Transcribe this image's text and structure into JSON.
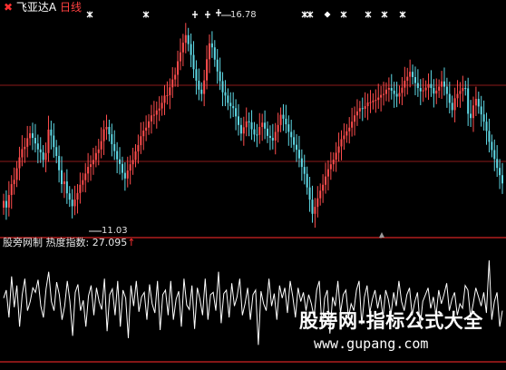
{
  "header": {
    "icon": "✖",
    "stock_name": "飞亚达A",
    "timeframe": "日线"
  },
  "indicator_header": {
    "source": "股旁网制",
    "name": "热度指数:",
    "value": "27.095",
    "arrow": "↑"
  },
  "annotations": {
    "high": "16.78",
    "low": "11.03"
  },
  "watermark": {
    "line1": "股旁网-指标公式大全",
    "line2": "www.gupang.com"
  },
  "colors": {
    "up": "#ff4d4d",
    "down": "#5fd9e6",
    "grid": "#8b1a1a",
    "axis": "#b01e1e",
    "line": "#ffffff",
    "marker": "#ffffff",
    "background": "#000000"
  },
  "chart_data": [
    {
      "type": "candlestick",
      "y_range": [
        10.7,
        17.4
      ],
      "high_label": 16.78,
      "low_label": 11.03,
      "closes": [
        11.7,
        11.5,
        11.88,
        12.21,
        12.34,
        12.69,
        13.02,
        13.27,
        13.34,
        13.6,
        13.75,
        13.61,
        13.44,
        13.26,
        13.17,
        12.94,
        13.15,
        13.86,
        13.68,
        13.33,
        13.06,
        12.63,
        12.21,
        12.29,
        11.93,
        11.74,
        11.54,
        11.74,
        11.94,
        12.19,
        12.33,
        12.53,
        12.73,
        12.81,
        12.94,
        13.15,
        13.26,
        13.51,
        13.87,
        13.94,
        13.72,
        13.42,
        13.21,
        12.96,
        12.82,
        12.55,
        12.38,
        12.62,
        12.81,
        12.94,
        13.2,
        13.39,
        13.66,
        13.83,
        13.92,
        14.11,
        14.29,
        14.31,
        14.44,
        14.5,
        14.67,
        14.89,
        14.9,
        15.14,
        15.38,
        15.52,
        15.93,
        16.2,
        16.49,
        16.72,
        16.45,
        16.12,
        15.69,
        15.34,
        15.07,
        14.94,
        15.35,
        15.99,
        16.47,
        16.35,
        15.98,
        15.62,
        15.33,
        14.99,
        14.89,
        14.67,
        14.57,
        14.51,
        14.26,
        14.0,
        13.74,
        13.93,
        14.11,
        14.08,
        13.87,
        13.71,
        13.7,
        13.94,
        14.07,
        13.89,
        13.67,
        13.61,
        13.53,
        13.79,
        14.0,
        14.31,
        14.19,
        14.02,
        13.79,
        13.63,
        13.4,
        13.25,
        12.99,
        12.73,
        12.52,
        12.11,
        11.74,
        11.31,
        11.52,
        11.78,
        12.01,
        12.19,
        12.44,
        12.66,
        12.81,
        12.95,
        13.16,
        13.35,
        13.57,
        13.68,
        13.81,
        13.92,
        14.1,
        14.29,
        14.41,
        14.51,
        14.49,
        14.57,
        14.68,
        14.69,
        14.74,
        14.76,
        14.83,
        14.91,
        14.94,
        15.07,
        15.12,
        15.04,
        14.94,
        14.86,
        14.97,
        15.13,
        15.34,
        15.46,
        15.61,
        15.45,
        15.27,
        15.12,
        15.02,
        15.05,
        15.13,
        15.24,
        15.12,
        14.95,
        15.04,
        15.16,
        15.32,
        15.16,
        14.94,
        14.67,
        14.45,
        14.81,
        14.94,
        15.03,
        15.12,
        15.11,
        14.34,
        14.21,
        14.59,
        14.79,
        14.56,
        14.32,
        14.1,
        13.82,
        13.49,
        13.24,
        12.97,
        12.7,
        12.48,
        12.23
      ]
    },
    {
      "type": "line",
      "name": "热度指数",
      "last_value": 27.095,
      "y_range": [
        0,
        100
      ],
      "values": [
        55,
        62,
        38,
        74,
        47,
        66,
        30,
        58,
        72,
        44,
        52,
        64,
        60,
        71,
        48,
        38,
        63,
        78,
        52,
        44,
        69,
        58,
        36,
        48,
        70,
        52,
        22,
        60,
        67,
        44,
        53,
        30,
        57,
        66,
        40,
        64,
        52,
        45,
        72,
        26,
        58,
        63,
        40,
        70,
        30,
        62,
        55,
        20,
        66,
        48,
        70,
        43,
        56,
        60,
        36,
        67,
        50,
        42,
        70,
        27,
        58,
        62,
        40,
        70,
        36,
        54,
        61,
        30,
        72,
        49,
        45,
        66,
        28,
        64,
        54,
        40,
        72,
        36,
        58,
        60,
        44,
        78,
        33,
        59,
        62,
        38,
        68,
        48,
        56,
        72,
        40,
        50,
        64,
        36,
        58,
        62,
        14,
        61,
        50,
        44,
        72,
        48,
        59,
        36,
        66,
        55,
        64,
        42,
        70,
        56,
        38,
        64,
        52,
        60,
        44,
        58,
        50,
        38,
        62,
        70,
        28,
        55,
        62,
        24,
        56,
        48,
        70,
        42,
        58,
        62,
        38,
        50,
        44,
        62,
        70,
        32,
        56,
        66,
        42,
        54,
        62,
        46,
        58,
        38,
        62,
        54,
        40,
        60,
        48,
        70,
        52,
        44,
        58,
        64,
        40,
        52,
        60,
        30,
        52,
        58,
        64,
        46,
        56,
        40,
        62,
        50,
        58,
        68,
        44,
        54,
        60,
        40,
        50,
        46,
        66,
        62,
        38,
        50,
        64,
        56,
        48,
        60,
        42,
        88,
        36,
        52,
        60,
        30,
        44
      ]
    }
  ]
}
